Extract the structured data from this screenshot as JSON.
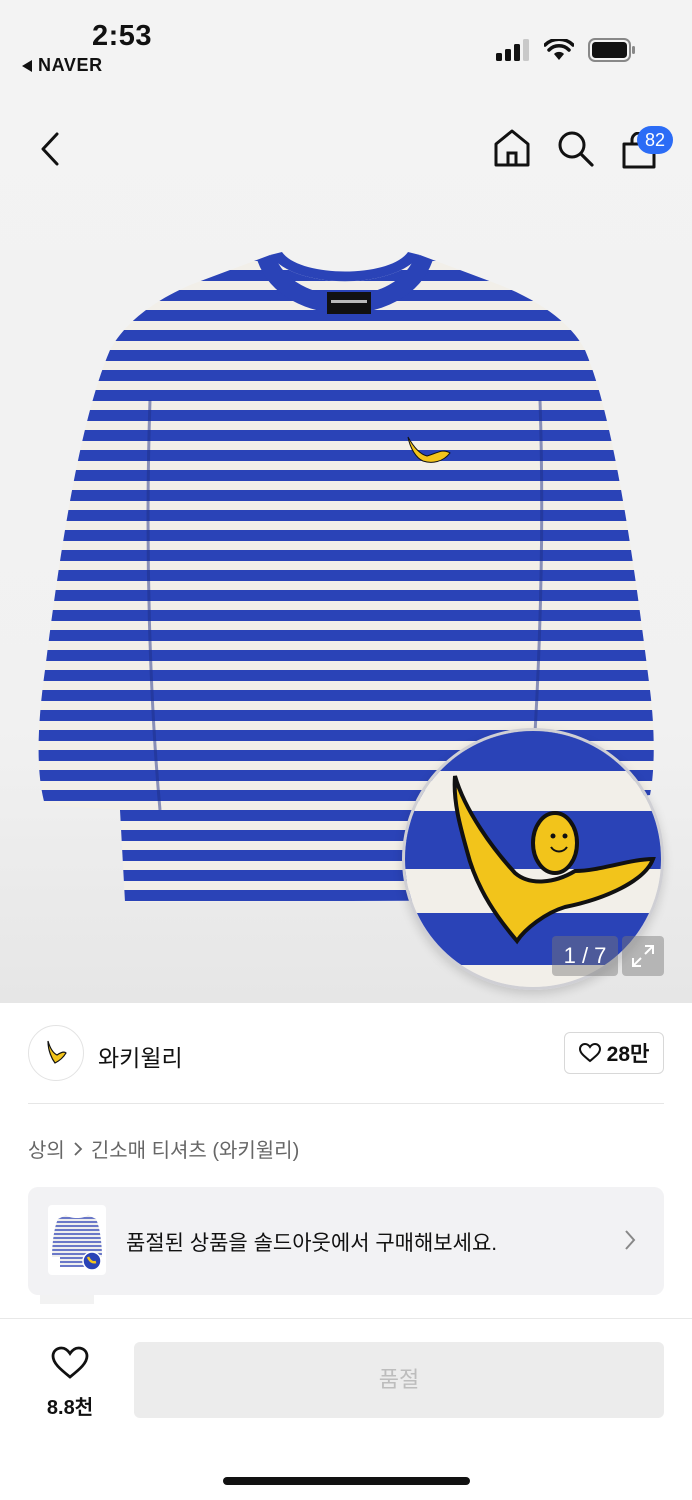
{
  "status_bar": {
    "time": "2:53",
    "back_app": "NAVER",
    "icons": [
      "cellular-signal-icon",
      "wifi-icon",
      "battery-icon"
    ]
  },
  "nav": {
    "cart_badge": "82",
    "icons": [
      "back-chevron-icon",
      "home-icon",
      "search-icon",
      "shopping-bag-icon"
    ]
  },
  "gallery": {
    "counter": "1 / 7"
  },
  "brand": {
    "name": "와키윌리",
    "likes": "28만"
  },
  "breadcrumb": {
    "category": "상의",
    "subcategory": "긴소매 티셔츠 (와키윌리)"
  },
  "soldout_banner": {
    "text": "품절된 상품을 솔드아웃에서 구매해보세요."
  },
  "bottom_bar": {
    "wish_count": "8.8천",
    "buy_button": "품절"
  },
  "colors": {
    "accent_blue": "#2b6cf6",
    "stripe_blue": "#2a43b7",
    "stripe_white": "#f2efe9",
    "duck_yellow": "#f2c41b"
  }
}
